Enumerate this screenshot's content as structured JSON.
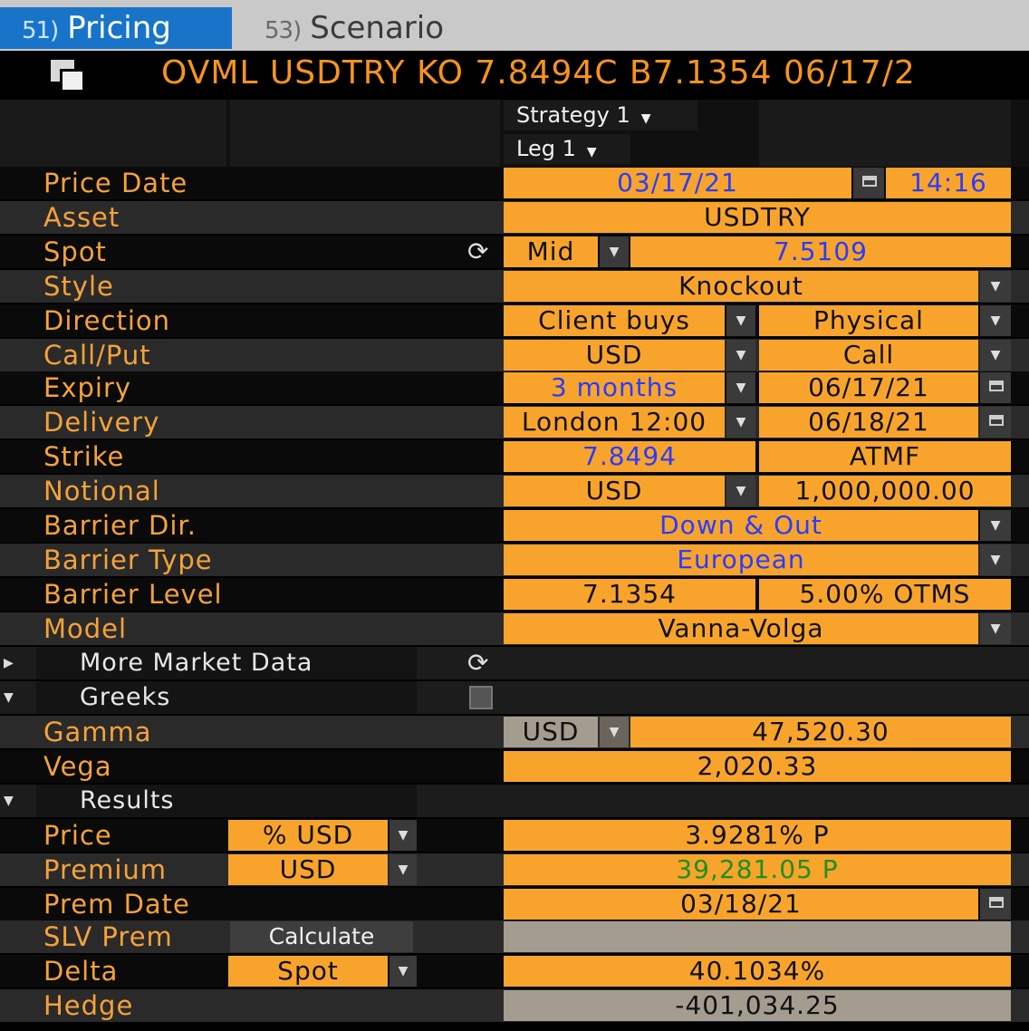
{
  "tabs": [
    {
      "num": "51)",
      "label": "Pricing"
    },
    {
      "num": "53)",
      "label": "Scenario"
    }
  ],
  "title": "OVML USDTRY KO 7.8494C B7.1354 06/17/2",
  "strategy_label": "Strategy 1",
  "leg_label": "Leg 1",
  "fields": {
    "price_date": {
      "label": "Price Date",
      "date": "03/17/21",
      "time": "14:16"
    },
    "asset": {
      "label": "Asset",
      "value": "USDTRY"
    },
    "spot": {
      "label": "Spot",
      "side": "Mid",
      "value": "7.5109"
    },
    "style": {
      "label": "Style",
      "value": "Knockout"
    },
    "direction": {
      "label": "Direction",
      "value": "Client buys",
      "settle": "Physical"
    },
    "callput": {
      "label": "Call/Put",
      "ccy": "USD",
      "value": "Call"
    },
    "expiry": {
      "label": "Expiry",
      "tenor": "3 months",
      "date": "06/17/21"
    },
    "delivery": {
      "label": "Delivery",
      "cut": "London 12:00",
      "date": "06/18/21"
    },
    "strike": {
      "label": "Strike",
      "value": "7.8494",
      "type": "ATMF"
    },
    "notional": {
      "label": "Notional",
      "ccy": "USD",
      "value": "1,000,000.00"
    },
    "barrier_dir": {
      "label": "Barrier Dir.",
      "value": "Down & Out"
    },
    "barrier_type": {
      "label": "Barrier Type",
      "value": "European"
    },
    "barrier_level": {
      "label": "Barrier Level",
      "value": "7.1354",
      "otms": "5.00% OTMS"
    },
    "model": {
      "label": "Model",
      "value": "Vanna-Volga"
    }
  },
  "sections": {
    "more_market_data": "More Market Data",
    "greeks": "Greeks",
    "results": "Results"
  },
  "greeks": {
    "gamma": {
      "label": "Gamma",
      "ccy": "USD",
      "value": "47,520.30"
    },
    "vega": {
      "label": "Vega",
      "value": "2,020.33"
    }
  },
  "results": {
    "price": {
      "label": "Price",
      "unit": "% USD",
      "value": "3.9281% P"
    },
    "premium": {
      "label": "Premium",
      "unit": "USD",
      "value": "39,281.05 P"
    },
    "prem_date": {
      "label": "Prem Date",
      "value": "03/18/21"
    },
    "slv_prem": {
      "label": "SLV Prem",
      "button": "Calculate",
      "value": ""
    },
    "delta": {
      "label": "Delta",
      "unit": "Spot",
      "value": "40.1034%"
    },
    "hedge": {
      "label": "Hedge",
      "value": "-401,034.25"
    }
  },
  "colors": {
    "field_bg": "#f8a42c",
    "label": "#f5a23a",
    "tab_active": "#1874c8",
    "blue_value": "#2a3cff",
    "green_value": "#1f8f1f",
    "readonly_bg": "#a59c90"
  }
}
